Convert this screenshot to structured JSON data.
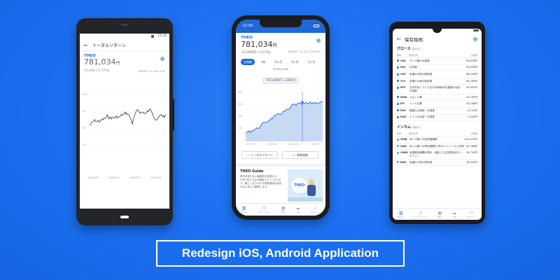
{
  "colors": {
    "background": "#1b6ff0",
    "accent": "#1e68d8",
    "chart_line": "#23344f",
    "fill_blue": "#c8d9f3"
  },
  "footer": {
    "label": "Redesign iOS, Android Application"
  },
  "phone_left": {
    "status_time": "12:30",
    "title": "トータルリターン",
    "brand": "THEO",
    "amount": "781,034",
    "unit": "円",
    "change": "12,466 (-1.57%)",
    "fx": "USD/JPY 111.67 4.34",
    "y_ticks": [
      "10%",
      "5%",
      "0%",
      "-5%"
    ],
    "x_ticks": [
      "18/06/30",
      "18/08/31",
      "18/10/31",
      "18/12/31"
    ]
  },
  "phone_mid": {
    "status_time": "12:00",
    "brand": "THEO",
    "amount": "781,034",
    "unit": "円",
    "change": "-12,466円 (-1.57%)",
    "fx": "USD/JPY 111.67 4.34/3.45",
    "periods": [
      "全期間",
      "1年",
      "6ヶ月",
      "3ヶ月",
      "1ヶ月"
    ],
    "tooltip_date": "2018/11/08",
    "tooltip_value": "¥703,809円 (+268円)",
    "y_ticks": [
      "800",
      "600",
      "400",
      "200"
    ],
    "x_ticks": [
      "18/07/31",
      "18/08/31",
      "18/09/30",
      "18/10/31"
    ],
    "button_return": "トータルリターン",
    "button_holdings": "保有銘柄",
    "guide_title": "THEO Guide",
    "guide_text": "資本を知らない最適的な投資から、THEOならではの運用アルゴリズムまで。難しくなりがちな資産運用の話を、今日ふまえて解説します。",
    "guide_brand": "THEO",
    "tabs": [
      "ホーム",
      "アクティビティ",
      "取引",
      "入金",
      "マイページ"
    ]
  },
  "phone_right": {
    "title": "保有銘柄",
    "section_growth": "グロース",
    "section_growth_sub": "株式など",
    "col_ticker": "略称",
    "col_name": "銘柄名称",
    "col_value": "評価額",
    "growth": [
      {
        "ticker": "VGK",
        "name": "ヨーロ圏の大型株",
        "value": "99,878円",
        "color": "#1e68d8"
      },
      {
        "ticker": "EWJ",
        "name": "日本株",
        "value": "99,459円",
        "color": "#1e68d8"
      },
      {
        "ticker": "VOE",
        "name": "米国の中型の割安株",
        "value": "96,434円",
        "color": "#1e68d8"
      },
      {
        "ticker": "VTV",
        "name": "米国の大型の割安株",
        "value": "96,289円",
        "color": "#1e68d8"
      },
      {
        "ticker": "EPP",
        "name": "日本を除くアジア太平洋地域の先進国の大型・中型株",
        "value": "25,847円",
        "color": "#1e68d8"
      },
      {
        "ticker": "EWW",
        "name": "メキシコ株",
        "value": "32,167円",
        "color": "#1e68d8"
      },
      {
        "ticker": "EPI",
        "name": "インド企業",
        "value": "30,236円",
        "color": "#1e68d8"
      },
      {
        "ticker": "EWY",
        "name": "韓国の大型株・中型株",
        "value": "6,191円",
        "color": "#1e68d8"
      },
      {
        "ticker": "EWG",
        "name": "ドイツの大型・中型株",
        "value": "2,945円",
        "color": "#1e68d8"
      }
    ],
    "section_income": "インカム",
    "section_income_sub": "債券など",
    "income": [
      {
        "ticker": "SPAB",
        "name": "米ドル建ての投資適格債",
        "value": "109,425円",
        "color": "#2fb9a3"
      },
      {
        "ticker": "SJNK",
        "name": "米ドル建ての残存期間0.5年のハイイールド社債",
        "value": "40,788円",
        "color": "#2fb9a3"
      },
      {
        "ticker": "VMBS",
        "name": "米国政府機関が発行・保証した住宅担保のモーゲージ...",
        "value": "39,752円",
        "color": "#2fb9a3"
      },
      {
        "ticker": "BWX",
        "name": "米国の小型の割安株",
        "value": "18,591円",
        "color": "#2fb9a3"
      }
    ],
    "tabs": [
      "ホーム",
      "アクティビティ",
      "取引",
      "入金",
      "マイページ"
    ]
  }
}
